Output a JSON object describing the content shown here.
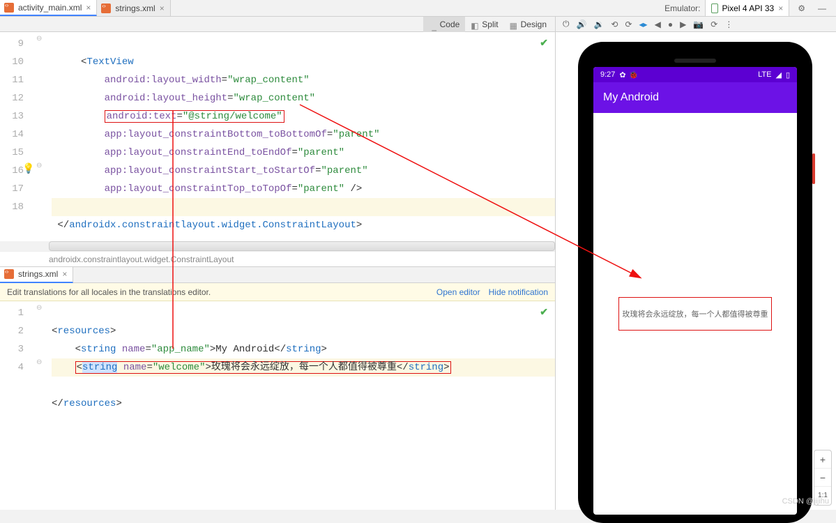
{
  "tabs": {
    "file1": "activity_main.xml",
    "file2": "strings.xml",
    "emu_label": "Emulator:",
    "device": "Pixel 4 API 33"
  },
  "mode_bar": {
    "code": "Code",
    "split": "Split",
    "design": "Design"
  },
  "editor_top": {
    "lines": [
      "9",
      "10",
      "11",
      "12",
      "13",
      "14",
      "15",
      "16",
      "17",
      "18"
    ],
    "l9_tag": "TextView",
    "l10_attr": "android:layout_width",
    "l10_val": "\"wrap_content\"",
    "l11_attr": "android:layout_height",
    "l11_val": "\"wrap_content\"",
    "l12_attr": "android:text",
    "l12_val": "\"@string/welcome\"",
    "l13_attr": "app:layout_constraintBottom_toBottomOf",
    "l13_val": "\"parent\"",
    "l14_attr": "app:layout_constraintEnd_toEndOf",
    "l14_val": "\"parent\"",
    "l15_attr": "app:layout_constraintStart_toStartOf",
    "l15_val": "\"parent\"",
    "l16_attr": "app:layout_constraintTop_toTopOf",
    "l16_val": "\"parent\"",
    "l16_end": " />",
    "l18_close": "androidx.constraintlayout.widget.ConstraintLayout",
    "breadcrumb": "androidx.constraintlayout.widget.ConstraintLayout"
  },
  "lower_tab": "strings.xml",
  "trans_bar": {
    "msg": "Edit translations for all locales in the translations editor.",
    "open": "Open editor",
    "hide": "Hide notification"
  },
  "editor_bot": {
    "lines": [
      "1",
      "2",
      "3",
      "4"
    ],
    "l1": "resources",
    "l2_tag": "string",
    "l2_name": "name",
    "l2_nv": "\"app_name\"",
    "l2_txt": "My Android",
    "l3_tag": "string",
    "l3_name": "name",
    "l3_nv": "\"welcome\"",
    "l3_txt": "玫瑰将会永远绽放，每一个人都值得被尊重",
    "l4": "resources"
  },
  "emulator": {
    "time": "9:27",
    "net": "LTE",
    "app_title": "My Android",
    "welcome": "玫瑰将会永远绽放，每一个人都值得被尊重",
    "zoom_fit": "1:1"
  },
  "watermark": "CSDN @jijihu"
}
